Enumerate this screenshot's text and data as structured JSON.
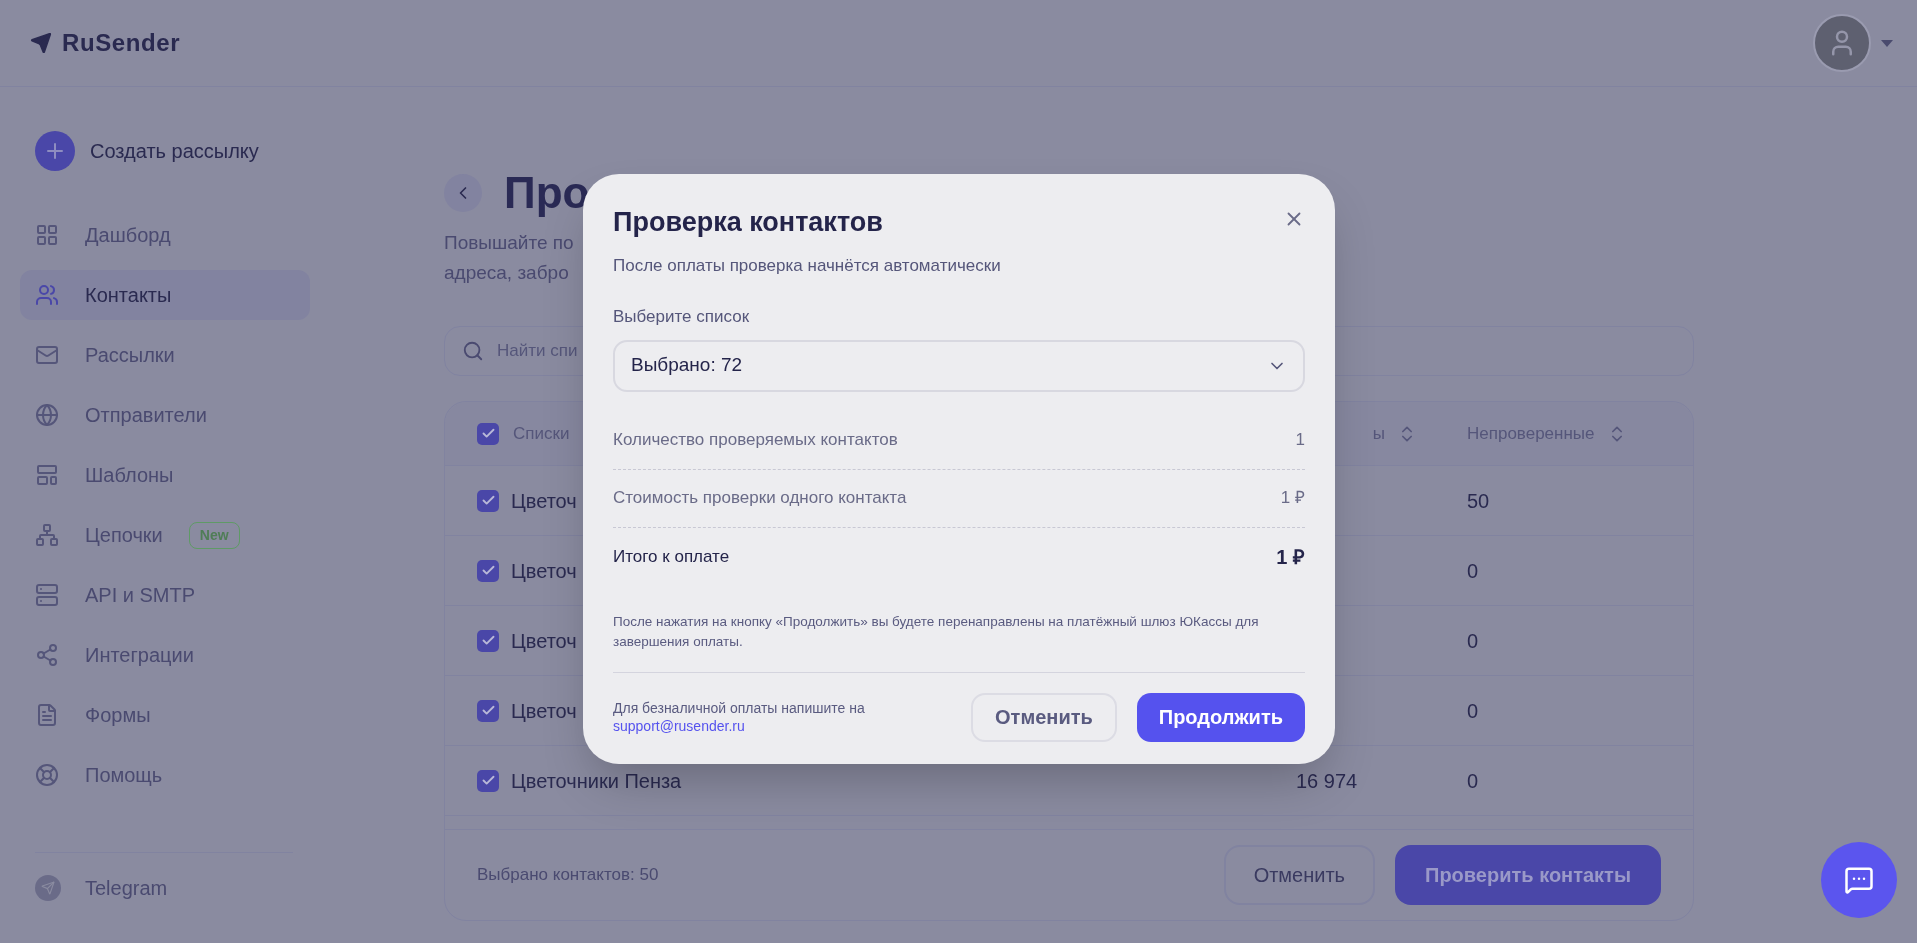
{
  "header": {
    "logo": "RuSender"
  },
  "sidebar": {
    "create_button": "Создать рассылку",
    "items": [
      {
        "label": "Дашборд",
        "selected": false
      },
      {
        "label": "Контакты",
        "selected": true
      },
      {
        "label": "Рассылки",
        "selected": false
      },
      {
        "label": "Отправители",
        "selected": false
      },
      {
        "label": "Шаблоны",
        "selected": false
      },
      {
        "label": "Цепочки",
        "selected": false,
        "badge": "New"
      },
      {
        "label": "API и SMTP",
        "selected": false
      },
      {
        "label": "Интеграции",
        "selected": false
      },
      {
        "label": "Формы",
        "selected": false
      },
      {
        "label": "Помощь",
        "selected": false
      }
    ],
    "footer_items": [
      {
        "label": "Telegram"
      }
    ]
  },
  "page": {
    "title": "Про",
    "subtitle_lines": [
      "Повышайте по",
      "адреса, забро"
    ],
    "search": {
      "placeholder": "Найти спи"
    },
    "table": {
      "header_checked": true,
      "columns": [
        {
          "label": "Списки"
        },
        {
          "label": "ы"
        },
        {
          "label": "Непроверенные"
        }
      ],
      "rows": [
        {
          "name": "Цветоч",
          "unverified": "50",
          "checked": true
        },
        {
          "name": "Цветоч",
          "unverified": "0",
          "checked": true
        },
        {
          "name": "Цветоч",
          "unverified": "0",
          "checked": true
        },
        {
          "name": "Цветоч",
          "unverified": "0",
          "checked": true
        },
        {
          "name": "Цветочники Пенза",
          "column_2": "16 974",
          "unverified": "0",
          "checked": true
        }
      ]
    },
    "footer": {
      "selected_count": "Выбрано контактов: 50",
      "cancel": "Отменить",
      "submit": "Проверить контакты"
    }
  },
  "dialog": {
    "title": "Проверка контактов",
    "subtitle": "После оплаты проверка начнётся автоматически",
    "select_label": "Выберите список",
    "select_value": "Выбрано: 72",
    "summary": [
      {
        "label": "Количество проверяемых контактов",
        "value": "1",
        "kind": "plain"
      },
      {
        "label": "Стоимость проверки одного контакта",
        "value": "1 ₽",
        "kind": "plain"
      },
      {
        "label": "Итого к оплате",
        "value": "1 ₽",
        "kind": "total"
      }
    ],
    "note": "После нажатия на кнопку «Продолжить» вы будете перенаправлены на платёжный шлюз ЮКассы для завершения оплаты.",
    "support_text": "Для безналичной оплаты напишите на",
    "support_link": "support@rusender.ru",
    "cancel": "Отменить",
    "confirm": "Продолжить"
  }
}
